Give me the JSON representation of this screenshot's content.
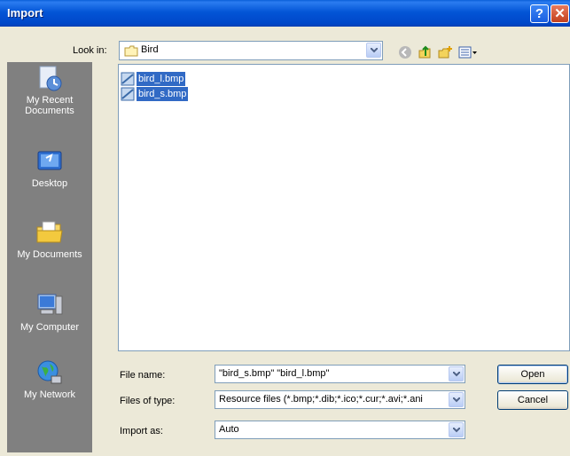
{
  "window": {
    "title": "Import"
  },
  "toolbar": {
    "look_in_label": "Look in:",
    "look_in_value": "Bird",
    "icons": [
      "back-icon",
      "up-folder-icon",
      "new-folder-icon",
      "views-menu-icon"
    ]
  },
  "places": [
    {
      "label": "My Recent\nDocuments",
      "icon": "recent-documents-icon"
    },
    {
      "label": "Desktop",
      "icon": "desktop-icon"
    },
    {
      "label": "My Documents",
      "icon": "my-documents-icon"
    },
    {
      "label": "My Computer",
      "icon": "my-computer-icon"
    },
    {
      "label": "My Network",
      "icon": "my-network-icon"
    }
  ],
  "files": [
    {
      "name": "bird_l.bmp",
      "selected": true
    },
    {
      "name": "bird_s.bmp",
      "selected": true
    }
  ],
  "form": {
    "file_name_label": "File name:",
    "file_name_value": "\"bird_s.bmp\" \"bird_l.bmp\"",
    "files_of_type_label": "Files of type:",
    "files_of_type_value": "Resource files (*.bmp;*.dib;*.ico;*.cur;*.avi;*.ani",
    "import_as_label": "Import as:",
    "import_as_value": "Auto"
  },
  "buttons": {
    "open": "Open",
    "cancel": "Cancel"
  },
  "colors": {
    "titlebar": "#0355d6",
    "selection": "#316ac5",
    "dialog_bg": "#ece9d8",
    "places_bg": "#808080"
  }
}
